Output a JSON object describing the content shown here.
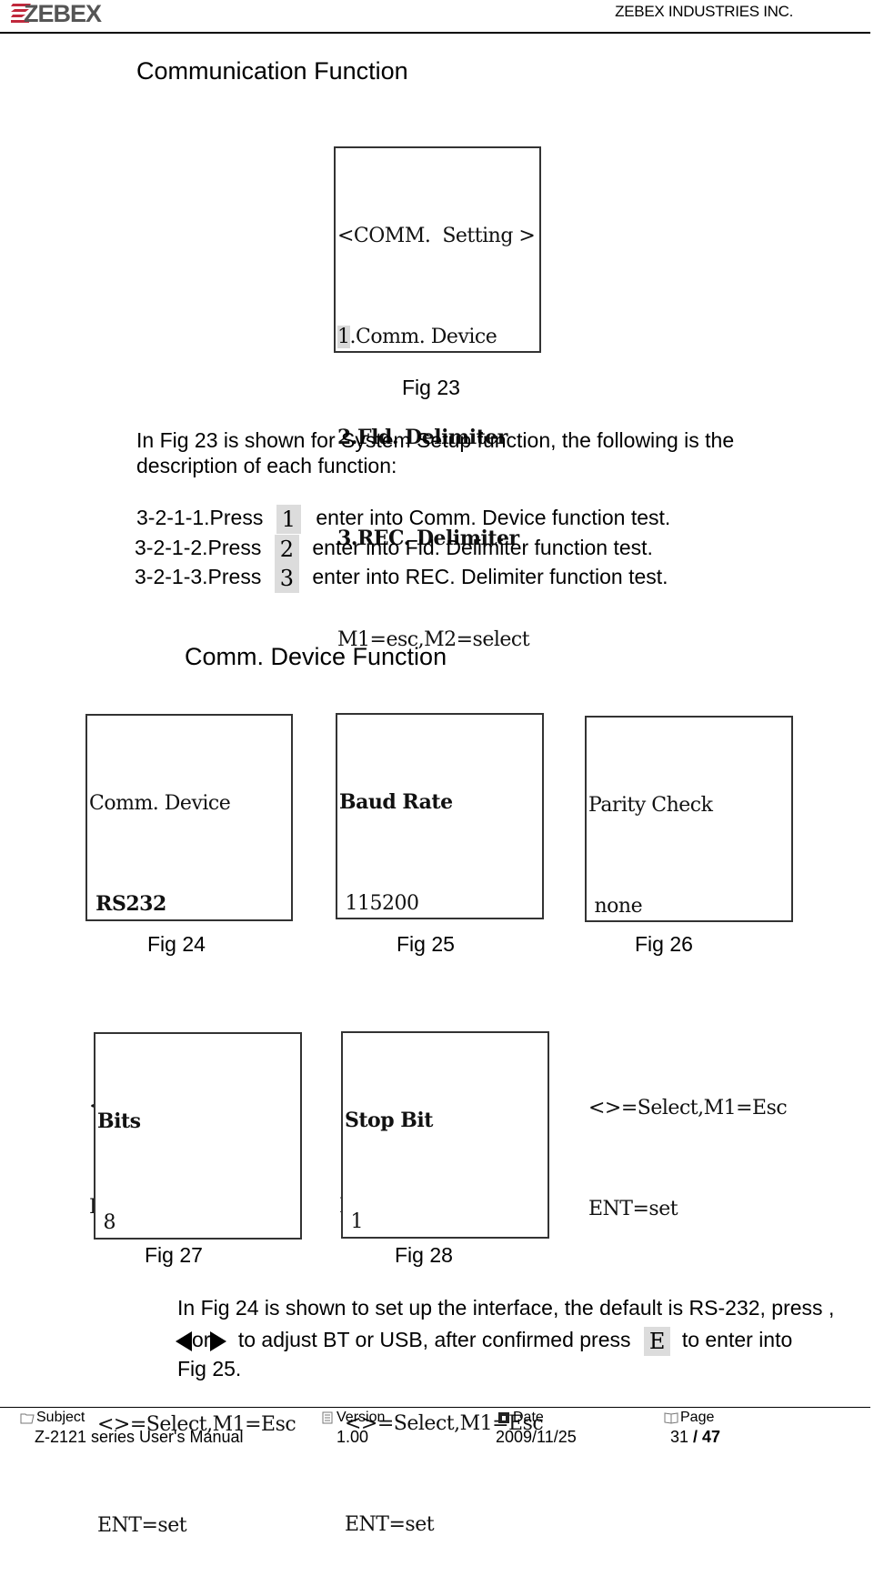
{
  "header": {
    "logo_text": "ZEBEX",
    "company": "ZEBEX INDUSTRIES INC."
  },
  "section_title": "Communication Function",
  "fig23": {
    "lines": [
      "<COMM.  Setting >",
      "1.Comm. Device",
      "2.Fld. Delimiter",
      "3.REC. Delimiter",
      "M1=esc,M2=select"
    ],
    "highlight_char": "1",
    "caption": "Fig 23"
  },
  "intro": {
    "line1": "In Fig 23 is shown for System Setup function, the following is the",
    "line2": "description of each function:"
  },
  "steps": [
    {
      "label": "3-2-1-1.Press",
      "key": "1",
      "text": "enter into Comm. Device function test."
    },
    {
      "label": "3-2-1-2.Press",
      "key": "2",
      "text": "enter into Fld. Delimiter function test."
    },
    {
      "label": "3-2-1-3.Press",
      "key": "3",
      "text": "enter into REC. Delimiter function test."
    }
  ],
  "subsection_title": "Comm. Device Function",
  "screens": [
    {
      "title": "Comm. Device",
      "value": " RS232",
      "hint": "<>=Select,M1=Esc",
      "set": "ENT=set",
      "caption": "Fig  24"
    },
    {
      "title": "Baud Rate",
      "value": " 115200",
      "hint": "<>=Select,M1=Esc",
      "set": "ENT=set",
      "caption": "Fig  25"
    },
    {
      "title": "Parity Check",
      "value": " none",
      "hint": "<>=Select,M1=Esc",
      "set": "ENT=set",
      "caption": "Fig  26"
    },
    {
      "title": "Bits",
      "value": " 8",
      "hint": "<>=Select,M1=Esc",
      "set": "ENT=set",
      "caption": "Fig  27"
    },
    {
      "title": "Stop Bit",
      "value": " 1",
      "hint": "<>=Select,M1=Esc",
      "set": "ENT=set",
      "caption": "Fig  28"
    }
  ],
  "closing": {
    "line1": "In Fig 24 is shown to set up the interface, the default is RS-232, press ,",
    "or_text": "or",
    "line2_mid": "to adjust BT or USB, after confirmed press",
    "key": "E",
    "line2_end": "to enter into",
    "line3": "Fig 25."
  },
  "footer": {
    "subject_label": "Subject",
    "subject_value": "Z-2121 series User's Manual",
    "version_label": "Version",
    "version_value": "1.00",
    "date_label": "Date",
    "date_value": "2009/11/25",
    "page_label": "Page",
    "page_current": "31",
    "page_sep": " / ",
    "page_total": "47"
  },
  "colors": {
    "logo_red": "#c0283c",
    "logo_gray": "#555555",
    "keycap_bg": "#dcdcdc"
  }
}
